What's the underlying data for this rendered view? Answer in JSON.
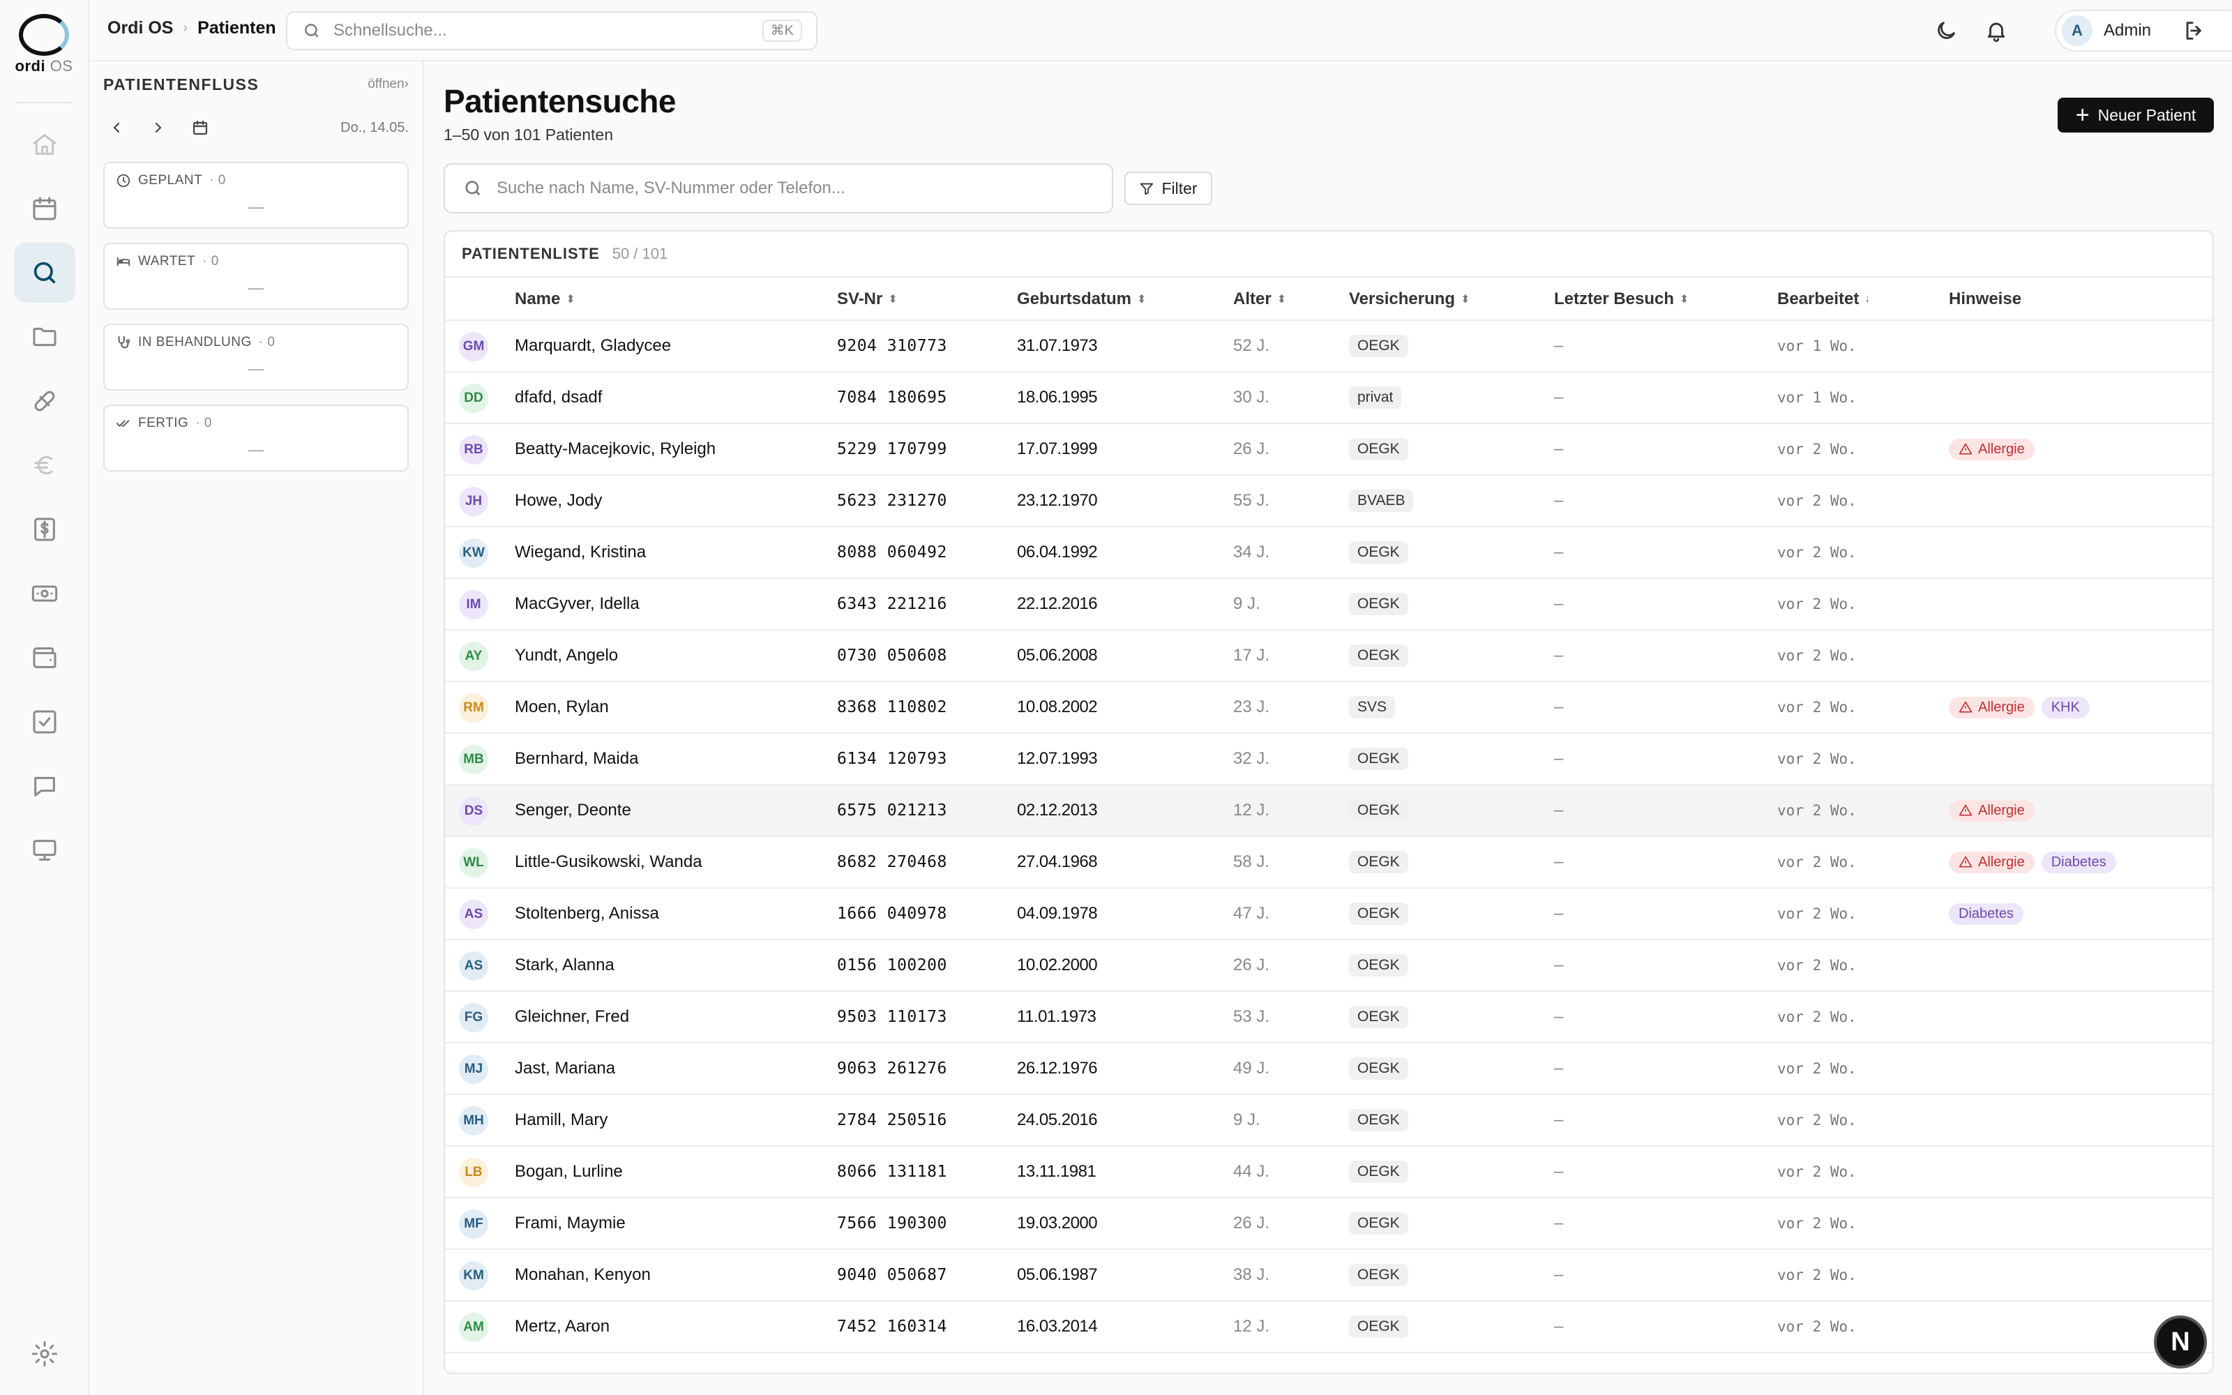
{
  "app": {
    "logo_text": "ordi",
    "logo_suffix": "OS"
  },
  "rail": [
    {
      "name": "home",
      "icon": "home-icon"
    },
    {
      "name": "calendar",
      "icon": "calendar-icon"
    },
    {
      "name": "search",
      "icon": "search-icon",
      "active": true
    },
    {
      "name": "folder",
      "icon": "folder-icon"
    },
    {
      "name": "medication",
      "icon": "pill-icon"
    },
    {
      "name": "euro",
      "icon": "euro-icon"
    },
    {
      "name": "billing",
      "icon": "dollar-document-icon"
    },
    {
      "name": "cash",
      "icon": "banknote-icon"
    },
    {
      "name": "wallet",
      "icon": "wallet-icon"
    },
    {
      "name": "tasks",
      "icon": "checkbox-icon"
    },
    {
      "name": "messages",
      "icon": "chat-icon"
    },
    {
      "name": "display",
      "icon": "monitor-icon"
    },
    {
      "name": "settings",
      "icon": "gear-icon"
    }
  ],
  "topbar": {
    "breadcrumb_root": "Ordi OS",
    "breadcrumb_sep": "›",
    "breadcrumb_current": "Patienten",
    "quick_search_placeholder": "Schnellsuche...",
    "quick_search_shortcut": "⌘K",
    "user_initial": "A",
    "user_name": "Admin"
  },
  "flow": {
    "title": "PATIENTENFLUSS",
    "open_link": "öffnen›",
    "date": "Do., 14.05.",
    "cards": [
      {
        "label": "GEPLANT",
        "count": "· 0",
        "empty": "—",
        "icon": "clock-icon"
      },
      {
        "label": "WARTET",
        "count": "· 0",
        "empty": "—",
        "icon": "bed-icon"
      },
      {
        "label": "IN BEHANDLUNG",
        "count": "· 0",
        "empty": "—",
        "icon": "stethoscope-icon"
      },
      {
        "label": "FERTIG",
        "count": "· 0",
        "empty": "—",
        "icon": "double-check-icon"
      }
    ]
  },
  "main": {
    "title": "Patientensuche",
    "subtitle": "1–50 von 101 Patienten",
    "new_button": "Neuer Patient",
    "search_placeholder": "Suche nach Name, SV-Nummer oder Telefon...",
    "filter_button": "Filter",
    "list_title": "PATIENTENLISTE",
    "list_count": "50 / 101"
  },
  "table": {
    "columns": {
      "name": "Name",
      "sv": "SV-Nr",
      "dob": "Geburtsdatum",
      "age": "Alter",
      "insurance": "Versicherung",
      "last_visit": "Letzter Besuch",
      "edited": "Bearbeitet",
      "notes": "Hinweise"
    },
    "sort_both": "⬍",
    "sort_desc": "↓",
    "rows": [
      {
        "initials": "GM",
        "name": "Marquardt, Gladycee",
        "sv": "9204 310773",
        "dob": "31.07.1973",
        "age": "52 J.",
        "insurance": "OEGK",
        "last": "–",
        "edited": "vor 1 Wo.",
        "notes": [],
        "color": "#6a4bb0",
        "bg": "#ede6fa"
      },
      {
        "initials": "DD",
        "name": "dfafd, dsadf",
        "sv": "7084 180695",
        "dob": "18.06.1995",
        "age": "30 J.",
        "insurance": "privat",
        "last": "–",
        "edited": "vor 1 Wo.",
        "notes": [],
        "color": "#2f8a4a",
        "bg": "#e2f4e6"
      },
      {
        "initials": "RB",
        "name": "Beatty-Macejkovic, Ryleigh",
        "sv": "5229 170799",
        "dob": "17.07.1999",
        "age": "26 J.",
        "insurance": "OEGK",
        "last": "–",
        "edited": "vor 2 Wo.",
        "notes": [
          {
            "text": "Allergie",
            "kind": "allergy"
          }
        ],
        "color": "#6a4bb0",
        "bg": "#ede6fa"
      },
      {
        "initials": "JH",
        "name": "Howe, Jody",
        "sv": "5623 231270",
        "dob": "23.12.1970",
        "age": "55 J.",
        "insurance": "BVAEB",
        "last": "–",
        "edited": "vor 2 Wo.",
        "notes": [],
        "color": "#6a4bb0",
        "bg": "#ede6fa"
      },
      {
        "initials": "KW",
        "name": "Wiegand, Kristina",
        "sv": "8088 060492",
        "dob": "06.04.1992",
        "age": "34 J.",
        "insurance": "OEGK",
        "last": "–",
        "edited": "vor 2 Wo.",
        "notes": [],
        "color": "#2a5d80",
        "bg": "#e1ecf5"
      },
      {
        "initials": "IM",
        "name": "MacGyver, Idella",
        "sv": "6343 221216",
        "dob": "22.12.2016",
        "age": "9 J.",
        "insurance": "OEGK",
        "last": "–",
        "edited": "vor 2 Wo.",
        "notes": [],
        "color": "#6a4bb0",
        "bg": "#ede6fa"
      },
      {
        "initials": "AY",
        "name": "Yundt, Angelo",
        "sv": "0730 050608",
        "dob": "05.06.2008",
        "age": "17 J.",
        "insurance": "OEGK",
        "last": "–",
        "edited": "vor 2 Wo.",
        "notes": [],
        "color": "#2f8a4a",
        "bg": "#e2f4e6"
      },
      {
        "initials": "RM",
        "name": "Moen, Rylan",
        "sv": "8368 110802",
        "dob": "10.08.2002",
        "age": "23 J.",
        "insurance": "SVS",
        "last": "–",
        "edited": "vor 2 Wo.",
        "notes": [
          {
            "text": "Allergie",
            "kind": "allergy"
          },
          {
            "text": "KHK",
            "kind": "other"
          }
        ],
        "color": "#c98a1a",
        "bg": "#fbf0da"
      },
      {
        "initials": "MB",
        "name": "Bernhard, Maida",
        "sv": "6134 120793",
        "dob": "12.07.1993",
        "age": "32 J.",
        "insurance": "OEGK",
        "last": "–",
        "edited": "vor 2 Wo.",
        "notes": [],
        "color": "#2f8a4a",
        "bg": "#e2f4e6"
      },
      {
        "initials": "DS",
        "name": "Senger, Deonte",
        "sv": "6575 021213",
        "dob": "02.12.2013",
        "age": "12 J.",
        "insurance": "OEGK",
        "last": "–",
        "edited": "vor 2 Wo.",
        "notes": [
          {
            "text": "Allergie",
            "kind": "allergy"
          }
        ],
        "color": "#6a4bb0",
        "bg": "#ede6fa",
        "highlight": true
      },
      {
        "initials": "WL",
        "name": "Little-Gusikowski, Wanda",
        "sv": "8682 270468",
        "dob": "27.04.1968",
        "age": "58 J.",
        "insurance": "OEGK",
        "last": "–",
        "edited": "vor 2 Wo.",
        "notes": [
          {
            "text": "Allergie",
            "kind": "allergy"
          },
          {
            "text": "Diabetes",
            "kind": "other"
          }
        ],
        "color": "#2f8a4a",
        "bg": "#e2f4e6"
      },
      {
        "initials": "AS",
        "name": "Stoltenberg, Anissa",
        "sv": "1666 040978",
        "dob": "04.09.1978",
        "age": "47 J.",
        "insurance": "OEGK",
        "last": "–",
        "edited": "vor 2 Wo.",
        "notes": [
          {
            "text": "Diabetes",
            "kind": "other"
          }
        ],
        "color": "#6a4bb0",
        "bg": "#ede6fa"
      },
      {
        "initials": "AS",
        "name": "Stark, Alanna",
        "sv": "0156 100200",
        "dob": "10.02.2000",
        "age": "26 J.",
        "insurance": "OEGK",
        "last": "–",
        "edited": "vor 2 Wo.",
        "notes": [],
        "color": "#2a5d80",
        "bg": "#e1ecf5"
      },
      {
        "initials": "FG",
        "name": "Gleichner, Fred",
        "sv": "9503 110173",
        "dob": "11.01.1973",
        "age": "53 J.",
        "insurance": "OEGK",
        "last": "–",
        "edited": "vor 2 Wo.",
        "notes": [],
        "color": "#2a5d80",
        "bg": "#e1ecf5"
      },
      {
        "initials": "MJ",
        "name": "Jast, Mariana",
        "sv": "9063 261276",
        "dob": "26.12.1976",
        "age": "49 J.",
        "insurance": "OEGK",
        "last": "–",
        "edited": "vor 2 Wo.",
        "notes": [],
        "color": "#2a5d80",
        "bg": "#e1ecf5"
      },
      {
        "initials": "MH",
        "name": "Hamill, Mary",
        "sv": "2784 250516",
        "dob": "24.05.2016",
        "age": "9 J.",
        "insurance": "OEGK",
        "last": "–",
        "edited": "vor 2 Wo.",
        "notes": [],
        "color": "#2a5d80",
        "bg": "#e1ecf5"
      },
      {
        "initials": "LB",
        "name": "Bogan, Lurline",
        "sv": "8066 131181",
        "dob": "13.11.1981",
        "age": "44 J.",
        "insurance": "OEGK",
        "last": "–",
        "edited": "vor 2 Wo.",
        "notes": [],
        "color": "#c98a1a",
        "bg": "#fbf0da"
      },
      {
        "initials": "MF",
        "name": "Frami, Maymie",
        "sv": "7566 190300",
        "dob": "19.03.2000",
        "age": "26 J.",
        "insurance": "OEGK",
        "last": "–",
        "edited": "vor 2 Wo.",
        "notes": [],
        "color": "#2a5d80",
        "bg": "#e1ecf5"
      },
      {
        "initials": "KM",
        "name": "Monahan, Kenyon",
        "sv": "9040 050687",
        "dob": "05.06.1987",
        "age": "38 J.",
        "insurance": "OEGK",
        "last": "–",
        "edited": "vor 2 Wo.",
        "notes": [],
        "color": "#2a5d80",
        "bg": "#e1ecf5"
      },
      {
        "initials": "AM",
        "name": "Mertz, Aaron",
        "sv": "7452 160314",
        "dob": "16.03.2014",
        "age": "12 J.",
        "insurance": "OEGK",
        "last": "–",
        "edited": "vor 2 Wo.",
        "notes": [],
        "color": "#2f8a4a",
        "bg": "#e2f4e6"
      }
    ]
  },
  "fab_label": "N"
}
